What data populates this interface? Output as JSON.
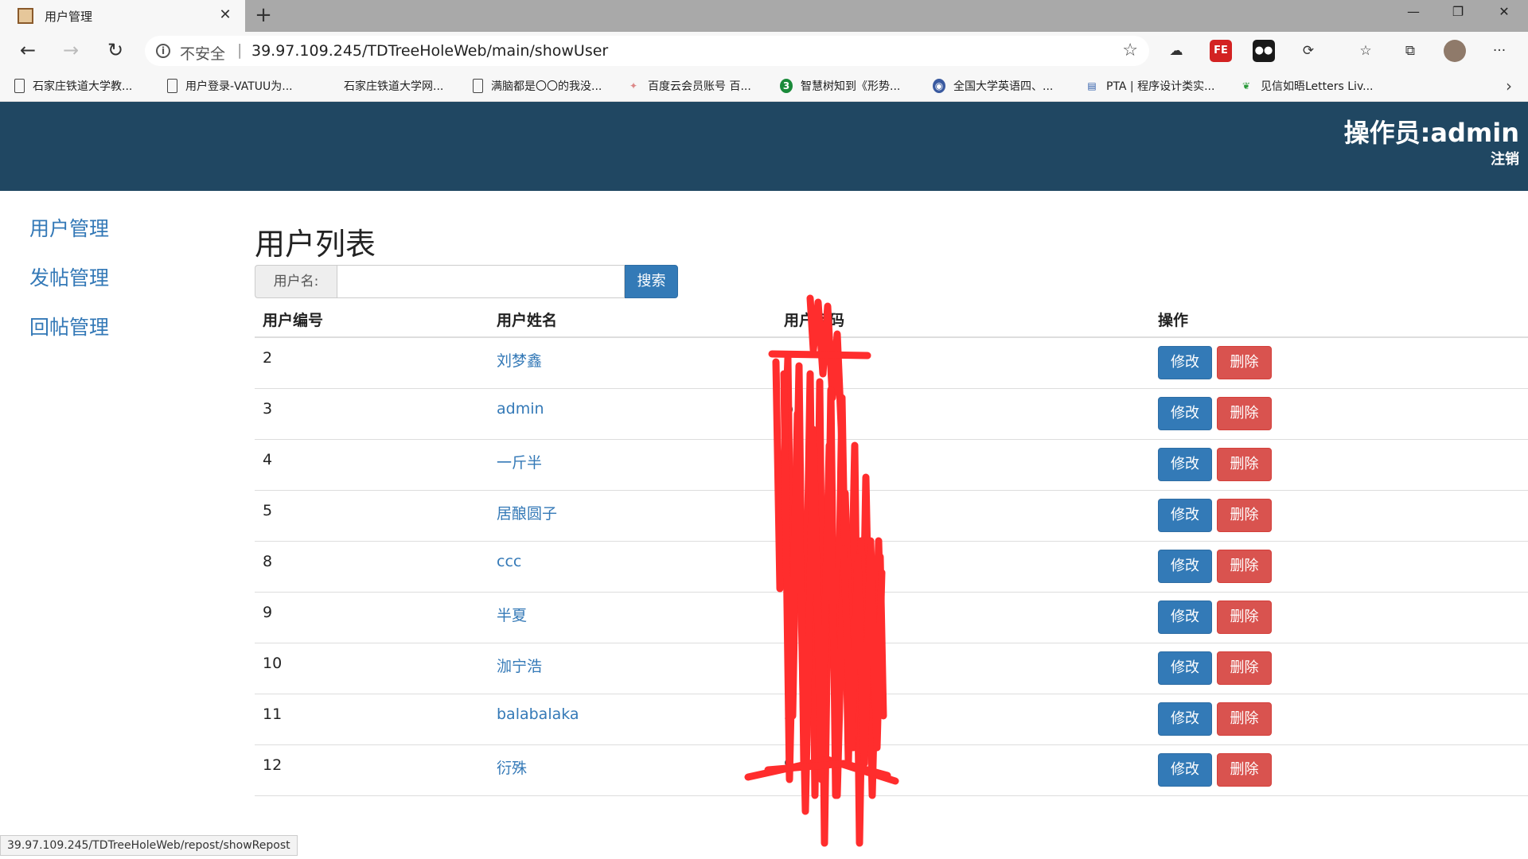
{
  "browser": {
    "tab_title": "用户管理",
    "tab_close": "✕",
    "new_tab": "+",
    "min": "—",
    "restore": "❐",
    "close": "✕",
    "back": "←",
    "forward": "→",
    "reload": "↻",
    "security_label": "不安全",
    "separator": "|",
    "url": "39.97.109.245/TDTreeHoleWeb/main/showUser",
    "star": "☆",
    "more": "···",
    "icons": [
      "cloud-icon",
      "fe-extension-icon",
      "panda-extension-icon",
      "sync-icon",
      "favorites-icon",
      "collections-icon",
      "profile-avatar"
    ]
  },
  "bookmarks": [
    {
      "label": "石家庄铁道大学教...",
      "icon": "document-icon"
    },
    {
      "label": "用户登录-VATUU为...",
      "icon": "document-icon"
    },
    {
      "label": "石家庄铁道大学网...",
      "icon": "blank-icon"
    },
    {
      "label": "满脑都是〇〇的我没...",
      "icon": "document-icon"
    },
    {
      "label": "百度云会员账号 百...",
      "icon": "star-icon"
    },
    {
      "label": "智慧树知到《形势...",
      "icon": "zhihuishu-icon",
      "badge": "3"
    },
    {
      "label": "全国大学英语四、...",
      "icon": "globe-icon"
    },
    {
      "label": "PTA | 程序设计类实...",
      "icon": "pta-icon"
    },
    {
      "label": "见信如晤Letters Liv...",
      "icon": "leaf-icon"
    }
  ],
  "bookmarks_more": "›",
  "header": {
    "operator": "操作员:admin",
    "logout": "注销",
    "bg_color": "#204762"
  },
  "sidebar": {
    "items": [
      {
        "label": "用户管理"
      },
      {
        "label": "发帖管理"
      },
      {
        "label": "回帖管理"
      }
    ]
  },
  "main": {
    "title": "用户列表",
    "search": {
      "addon": "用户名:",
      "value": "",
      "button": "搜索"
    },
    "columns": [
      "用户编号",
      "用户姓名",
      "用户密码",
      "操作"
    ],
    "edit_label": "修改",
    "delete_label": "删除",
    "rows": [
      {
        "id": "2",
        "name": "刘梦鑫",
        "pwd": ""
      },
      {
        "id": "3",
        "name": "admin",
        "pwd": "b"
      },
      {
        "id": "4",
        "name": "一斤半",
        "pwd": "56"
      },
      {
        "id": "5",
        "name": "居酿圆子",
        "pwd": ""
      },
      {
        "id": "8",
        "name": "ccc",
        "pwd": "c"
      },
      {
        "id": "9",
        "name": "半夏",
        "pwd": "yr 39."
      },
      {
        "id": "10",
        "name": "泇宁浩",
        "pwd": ""
      },
      {
        "id": "11",
        "name": "balabalaka",
        "pwd": "2"
      },
      {
        "id": "12",
        "name": "衍殊",
        "pwd": "9"
      }
    ]
  },
  "statusbar": "39.97.109.245/TDTreeHoleWeb/repost/showRepost",
  "colors": {
    "primary": "#337ab7",
    "danger": "#d9534f",
    "link": "#3479b7",
    "scribble": "#ff2d2d"
  }
}
